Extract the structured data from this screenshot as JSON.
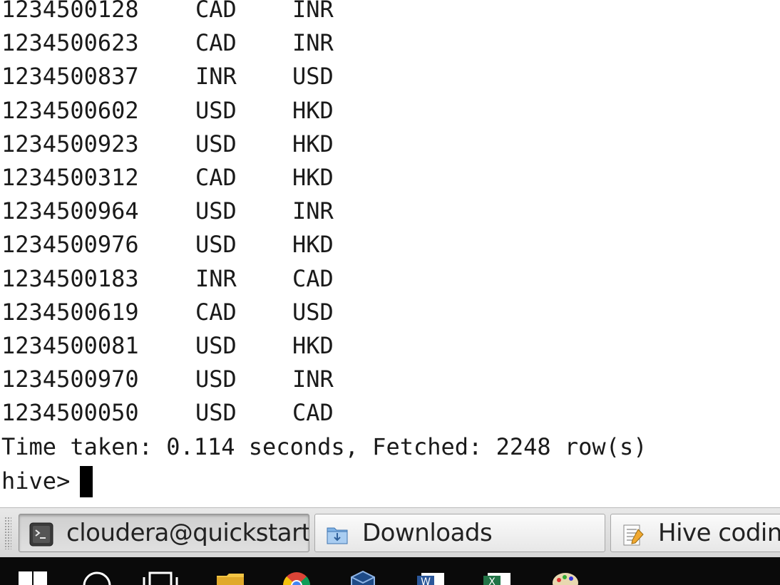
{
  "terminal": {
    "rows": [
      {
        "id": "1234500128",
        "from": "CAD",
        "to": "INR"
      },
      {
        "id": "1234500623",
        "from": "CAD",
        "to": "INR"
      },
      {
        "id": "1234500837",
        "from": "INR",
        "to": "USD"
      },
      {
        "id": "1234500602",
        "from": "USD",
        "to": "HKD"
      },
      {
        "id": "1234500923",
        "from": "USD",
        "to": "HKD"
      },
      {
        "id": "1234500312",
        "from": "CAD",
        "to": "HKD"
      },
      {
        "id": "1234500964",
        "from": "USD",
        "to": "INR"
      },
      {
        "id": "1234500976",
        "from": "USD",
        "to": "HKD"
      },
      {
        "id": "1234500183",
        "from": "INR",
        "to": "CAD"
      },
      {
        "id": "1234500619",
        "from": "CAD",
        "to": "USD"
      },
      {
        "id": "1234500081",
        "from": "USD",
        "to": "HKD"
      },
      {
        "id": "1234500970",
        "from": "USD",
        "to": "INR"
      },
      {
        "id": "1234500050",
        "from": "USD",
        "to": "CAD"
      }
    ],
    "summary": "Time taken: 0.114 seconds, Fetched: 2248 row(s)",
    "prompt": "hive>"
  },
  "window_panel": {
    "tasks": [
      {
        "label": "cloudera@quickstart:~",
        "icon": "terminal-icon",
        "active": true
      },
      {
        "label": "Downloads",
        "icon": "folder-icon",
        "active": false
      },
      {
        "label": "Hive coding.t",
        "icon": "text-editor-icon",
        "active": false
      }
    ]
  },
  "os_taskbar": {
    "icons": [
      "windows-start-icon",
      "search-icon",
      "task-view-icon",
      "file-explorer-icon",
      "chrome-icon",
      "virtualbox-icon",
      "word-icon",
      "excel-icon",
      "paint-icon"
    ]
  },
  "colors": {
    "terminal_bg": "#ffffff",
    "terminal_text": "#1a1a1a",
    "panel_bg": "#e0e0e0",
    "taskbar_bg": "#0a0a0a"
  }
}
